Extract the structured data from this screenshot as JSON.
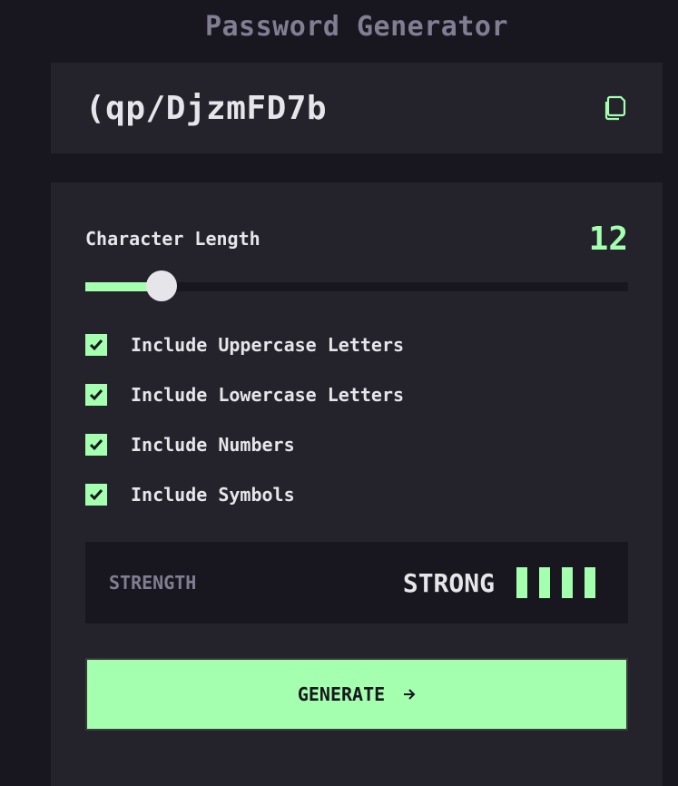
{
  "app": {
    "title": "Password Generator"
  },
  "password": {
    "value": "(qp/DjzmFD7b",
    "copy_icon": "copy-icon"
  },
  "length": {
    "label": "Character Length",
    "value": "12",
    "slider_fraction": 0.14
  },
  "options": [
    {
      "label": "Include Uppercase Letters",
      "checked": true
    },
    {
      "label": "Include Lowercase Letters",
      "checked": true
    },
    {
      "label": "Include Numbers",
      "checked": true
    },
    {
      "label": "Include Symbols",
      "checked": true
    }
  ],
  "strength": {
    "label": "STRENGTH",
    "value": "STRONG",
    "bars_filled": 4,
    "bars_total": 4
  },
  "generate": {
    "label": "GENERATE",
    "icon": "arrow-right-icon"
  },
  "colors": {
    "accent": "#a4ffaf",
    "background": "#18171f",
    "panel": "#24232c",
    "text": "#e6e5ea",
    "muted": "#817d92"
  }
}
